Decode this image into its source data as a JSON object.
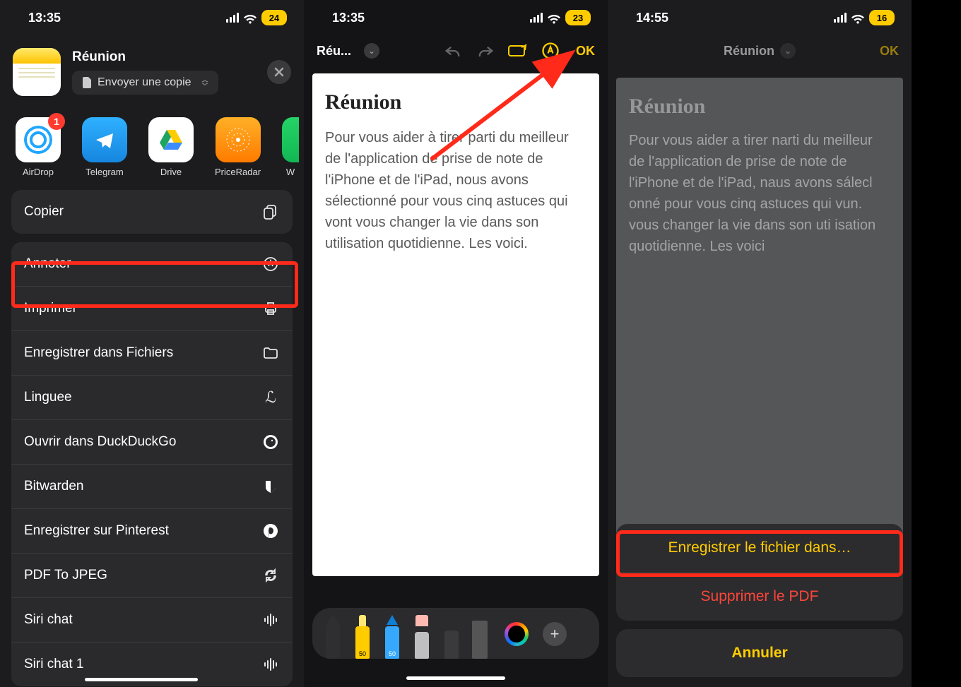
{
  "phone1": {
    "status": {
      "time": "13:35",
      "battery": "24"
    },
    "share": {
      "title": "Réunion",
      "sendCopy": "Envoyer une copie",
      "apps": [
        {
          "name": "airdrop",
          "label": "AirDrop",
          "badge": "1"
        },
        {
          "name": "telegram",
          "label": "Telegram"
        },
        {
          "name": "drive",
          "label": "Drive"
        },
        {
          "name": "priceradar",
          "label": "PriceRadar"
        },
        {
          "name": "whatsapp",
          "label": "W"
        }
      ],
      "copy": "Copier",
      "actions": [
        {
          "key": "annoter",
          "label": "Annoter"
        },
        {
          "key": "imprimer",
          "label": "Imprimer"
        },
        {
          "key": "save-files",
          "label": "Enregistrer dans Fichiers"
        },
        {
          "key": "linguee",
          "label": "Linguee"
        },
        {
          "key": "duckduckgo",
          "label": "Ouvrir dans DuckDuckGo"
        },
        {
          "key": "bitwarden",
          "label": "Bitwarden"
        },
        {
          "key": "pinterest",
          "label": "Enregistrer sur Pinterest"
        },
        {
          "key": "pdfjpeg",
          "label": "PDF To JPEG"
        },
        {
          "key": "sirichat",
          "label": "Siri chat"
        },
        {
          "key": "sirichat1",
          "label": "Siri chat 1"
        }
      ]
    }
  },
  "phone2": {
    "status": {
      "time": "13:35",
      "battery": "23"
    },
    "toolbar": {
      "title": "Réu...",
      "ok": "OK"
    },
    "doc": {
      "title": "Réunion",
      "body": "Pour vous aider à tirer parti du meilleur de l'application de prise de note de l'iPhone et de l'iPad, nous avons sélectionné pour vous cinq astuces qui vont vous changer la vie dans son utilisation quotidienne. Les voici."
    },
    "tools": {
      "marker_label": "50",
      "pencil_label": "50"
    }
  },
  "phone3": {
    "status": {
      "time": "14:55",
      "battery": "16"
    },
    "toolbar": {
      "title": "Réunion",
      "ok": "OK"
    },
    "doc": {
      "title": "Réunion",
      "body": "Pour vous aider a tirer narti du meilleur de l'application de prise de note de l'iPhone et de l'iPad, naus avons sálecl onné pour vous cinq astuces qui vun. vous changer la vie dans son uti isation quotidienne. Les voici"
    },
    "sheet": {
      "save": "Enregistrer le fichier dans…",
      "delete": "Supprimer le PDF",
      "cancel": "Annuler"
    }
  }
}
